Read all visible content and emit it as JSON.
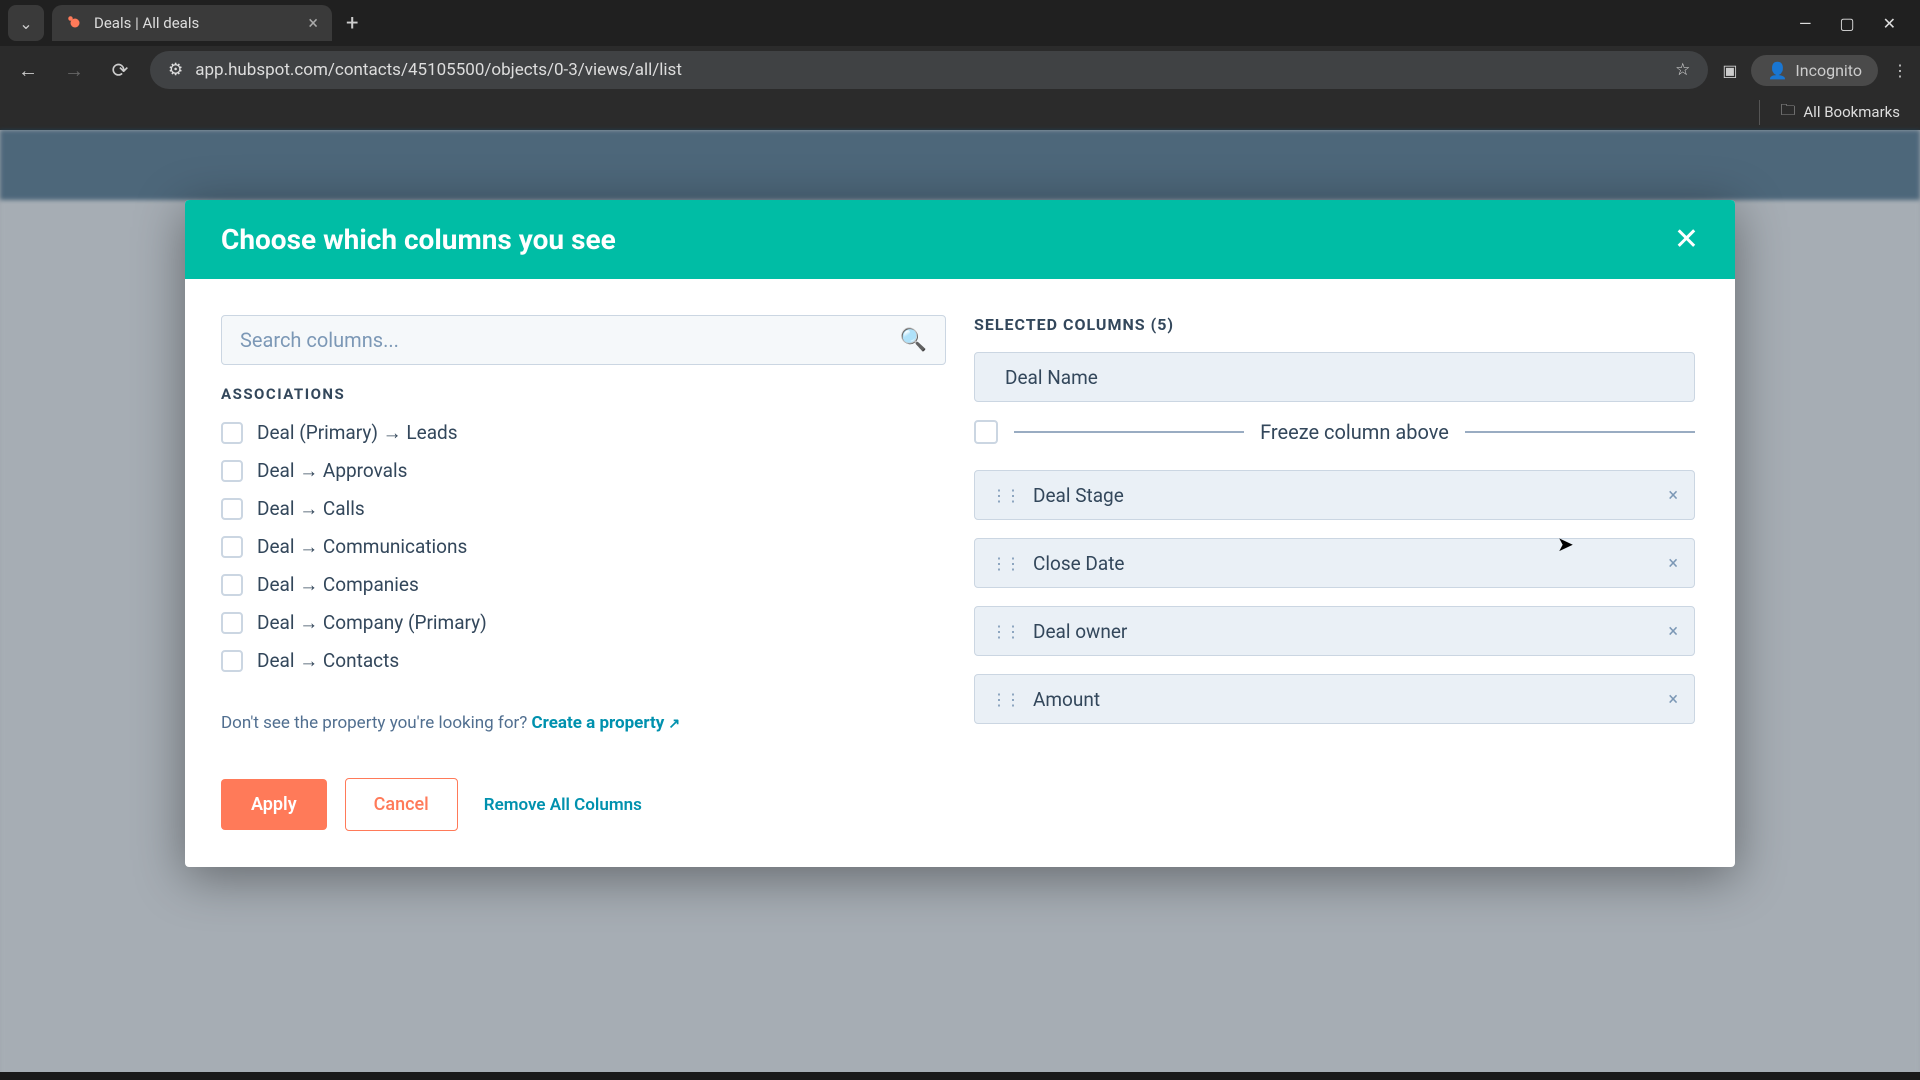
{
  "browser": {
    "tab_title": "Deals | All deals",
    "url": "app.hubspot.com/contacts/45105500/objects/0-3/views/all/list",
    "incognito_label": "Incognito",
    "bookmarks_label": "All Bookmarks"
  },
  "modal": {
    "title": "Choose which columns you see",
    "search_placeholder": "Search columns...",
    "section_label": "ASSOCIATIONS",
    "associations": [
      "Deal (Primary) → Leads",
      "Deal → Approvals",
      "Deal → Calls",
      "Deal → Communications",
      "Deal → Companies",
      "Deal → Company (Primary)",
      "Deal → Contacts"
    ],
    "create_prompt": "Don't see the property you're looking for? ",
    "create_link": "Create a property",
    "selected_title": "SELECTED COLUMNS (5)",
    "freeze_label": "Freeze column above",
    "selected_columns": [
      "Deal Name",
      "Deal Stage",
      "Close Date",
      "Deal owner",
      "Amount"
    ],
    "apply_label": "Apply",
    "cancel_label": "Cancel",
    "remove_all_label": "Remove All Columns"
  }
}
